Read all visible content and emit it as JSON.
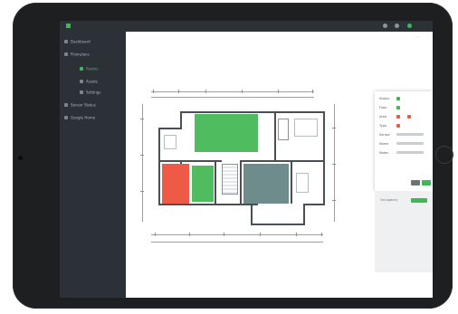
{
  "app": {
    "header_icons": [
      "logo-icon",
      "bell-icon",
      "user-icon",
      "settings-icon"
    ]
  },
  "colors": {
    "accent": "#43b655",
    "red_room": "#ef5a47",
    "green_room": "#4fbd5f",
    "teal_room": "#5f7f80",
    "sidebar": "#2c3137"
  },
  "sidebar": {
    "items": [
      {
        "label": "Dashboard",
        "icon": "grid-icon"
      },
      {
        "label": "Floorplans",
        "icon": "layout-icon"
      },
      {
        "label": "Rooms",
        "icon": "room-icon",
        "active": true
      },
      {
        "label": "Assets",
        "icon": "box-icon"
      },
      {
        "label": "Settings",
        "icon": "gear-icon"
      },
      {
        "label": "Sensor Status",
        "icon": "sensor-icon"
      },
      {
        "label": "Google Home",
        "icon": "home-icon"
      }
    ]
  },
  "panel": {
    "rows": [
      {
        "label": "Status",
        "chip_color": "#43b655"
      },
      {
        "label": "Floor",
        "chip_color": "#43b655"
      },
      {
        "label": "Area",
        "chip_color": "#e85b4a"
      },
      {
        "label": "Type",
        "chip_color": "#e85b4a"
      },
      {
        "label": "Sensor",
        "chip_color": "#9aa0a6"
      },
      {
        "label": "Name",
        "chip_color": "#9aa0a6"
      },
      {
        "label": "Notes",
        "chip_color": "#9aa0a6"
      }
    ]
  },
  "panel2": {
    "text": "Occupancy",
    "button_color": "#43b655"
  }
}
